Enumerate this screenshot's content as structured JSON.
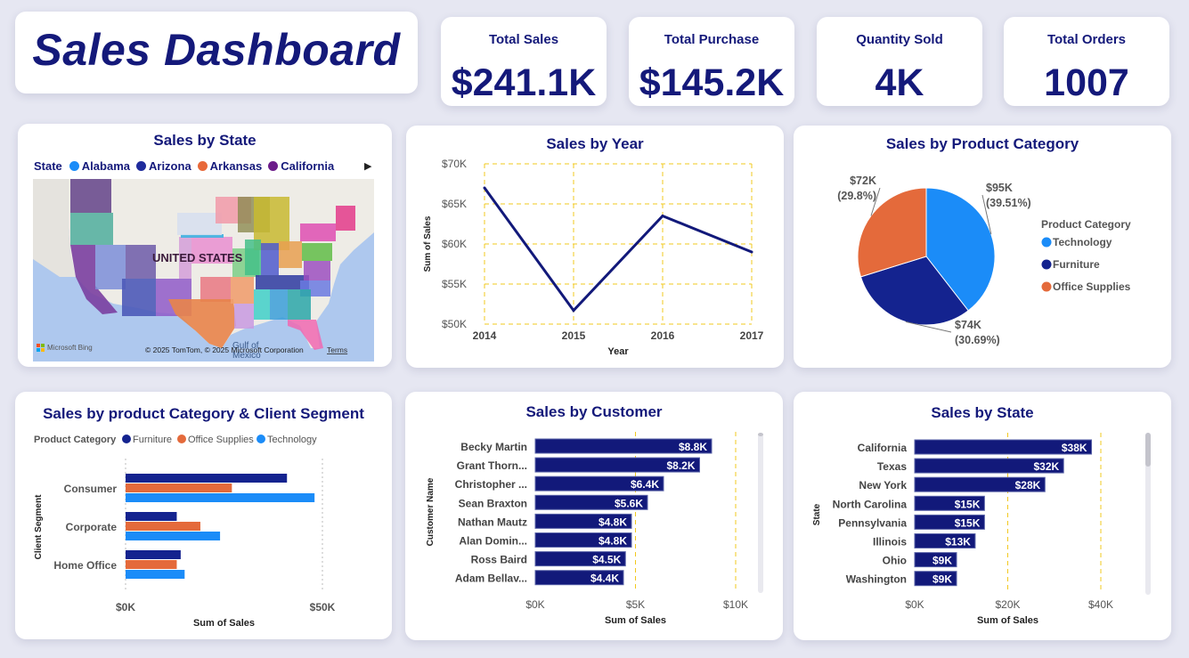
{
  "dashboard_title": "Sales Dashboard",
  "kpis": [
    {
      "label": "Total Sales",
      "value": "$241.1K"
    },
    {
      "label": "Total Purchase",
      "value": "$145.2K"
    },
    {
      "label": "Quantity Sold",
      "value": "4K"
    },
    {
      "label": "Total Orders",
      "value": "1007"
    }
  ],
  "map": {
    "title": "Sales by State",
    "legend_label": "State",
    "legend_items": [
      {
        "label": "Alabama",
        "color": "#1b8cf8"
      },
      {
        "label": "Arizona",
        "color": "#1f2b9c"
      },
      {
        "label": "Arkansas",
        "color": "#e8693a"
      },
      {
        "label": "California",
        "color": "#6c1c8a"
      }
    ],
    "country_label": "UNITED STATES",
    "gulf_label_1": "Gulf of",
    "gulf_label_2": "Mexico",
    "bing_label": "Microsoft Bing",
    "copyright": "© 2025 TomTom, © 2025 Microsoft Corporation",
    "terms": "Terms",
    "more_icon": "chevron-right-icon"
  },
  "colors": {
    "technology": "#1b8cf8",
    "furniture": "#14238f",
    "office_supplies": "#e46a3b",
    "bar": "#12197a",
    "gridline": "#f2c81e"
  },
  "chart_data": [
    {
      "type": "line",
      "title": "Sales by Year",
      "xlabel": "Year",
      "ylabel": "Sum of Sales",
      "x": [
        2014,
        2015,
        2016,
        2017
      ],
      "series": [
        {
          "values": [
            67000,
            51700,
            63500,
            59000
          ]
        }
      ],
      "ylim": [
        50000,
        70000
      ],
      "y_ticks": [
        "$50K",
        "$55K",
        "$60K",
        "$65K",
        "$70K"
      ],
      "grid": true
    },
    {
      "type": "pie",
      "title": "Sales by Product Category",
      "legend_title": "Product Category",
      "legend_position": "right",
      "slices": [
        {
          "label": "Technology",
          "value": 95,
          "percent": 39.51,
          "amount": "$95K",
          "percent_label": "(39.51%)"
        },
        {
          "label": "Furniture",
          "value": 74,
          "percent": 30.69,
          "amount": "$74K",
          "percent_label": "(30.69%)"
        },
        {
          "label": "Office Supplies",
          "value": 72,
          "percent": 29.8,
          "amount": "$72K",
          "percent_label": "(29.8%)"
        }
      ]
    },
    {
      "type": "bar",
      "orientation": "horizontal",
      "title": "Sales by product Category & Client Segment",
      "legend_title": "Product Category",
      "legend_position": "top-left",
      "categories": [
        "Consumer",
        "Corporate",
        "Home Office"
      ],
      "series": [
        {
          "name": "Furniture",
          "values": [
            41000,
            13000,
            14000
          ]
        },
        {
          "name": "Office Supplies",
          "values": [
            27000,
            19000,
            13000
          ]
        },
        {
          "name": "Technology",
          "values": [
            48000,
            24000,
            15000
          ]
        }
      ],
      "xlabel": "Sum of Sales",
      "ylabel": "Client Segment",
      "xlim": [
        0,
        50000
      ],
      "x_ticks": [
        "$0K",
        "$50K"
      ]
    },
    {
      "type": "bar",
      "orientation": "horizontal",
      "title": "Sales by Customer",
      "categories": [
        "Becky Martin",
        "Grant Thorn...",
        "Christopher ...",
        "Sean Braxton",
        "Nathan Mautz",
        "Alan Domin...",
        "Ross Baird",
        "Adam Bellav..."
      ],
      "values": [
        8800,
        8200,
        6400,
        5600,
        4800,
        4800,
        4500,
        4400
      ],
      "data_labels": [
        "$8.8K",
        "$8.2K",
        "$6.4K",
        "$5.6K",
        "$4.8K",
        "$4.8K",
        "$4.5K",
        "$4.4K"
      ],
      "xlabel": "Sum of Sales",
      "ylabel": "Customer Name",
      "xlim": [
        0,
        10000
      ],
      "x_ticks": [
        "$0K",
        "$5K",
        "$10K"
      ]
    },
    {
      "type": "bar",
      "orientation": "horizontal",
      "title": "Sales by State",
      "categories": [
        "California",
        "Texas",
        "New York",
        "North Carolina",
        "Pennsylvania",
        "Illinois",
        "Ohio",
        "Washington"
      ],
      "values": [
        38000,
        32000,
        28000,
        15000,
        15000,
        13000,
        9000,
        9000
      ],
      "data_labels": [
        "$38K",
        "$32K",
        "$28K",
        "$15K",
        "$15K",
        "$13K",
        "$9K",
        "$9K"
      ],
      "xlabel": "Sum of Sales",
      "ylabel": "State",
      "xlim": [
        0,
        40000
      ],
      "x_ticks": [
        "$0K",
        "$20K",
        "$40K"
      ]
    }
  ]
}
